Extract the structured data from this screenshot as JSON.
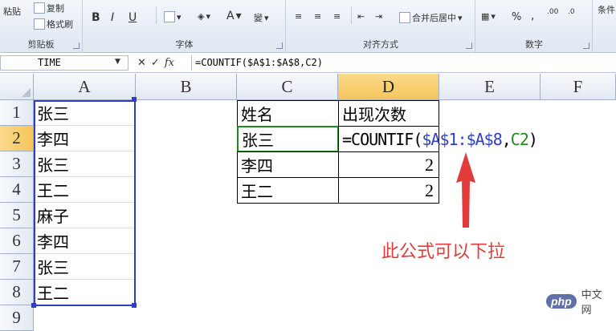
{
  "ribbon": {
    "clipboard": {
      "paste": "粘贴",
      "copy": "复制",
      "format_painter": "格式刷",
      "label": "剪贴板"
    },
    "font": {
      "label": "字体",
      "bold": "B",
      "italic": "I",
      "underline": "U"
    },
    "alignment": {
      "label": "对齐方式",
      "merge_center": "合并后居中"
    },
    "number": {
      "label": "数字",
      "percent": "%",
      "comma": ","
    },
    "conditional": "条件"
  },
  "formula_bar": {
    "name_box": "TIME",
    "cancel": "✕",
    "enter": "✓",
    "fx": "fx",
    "formula": "=COUNTIF($A$1:$A$8,C2)"
  },
  "columns": [
    "A",
    "B",
    "C",
    "D",
    "E",
    "F"
  ],
  "rows": [
    "1",
    "2",
    "3",
    "4",
    "5",
    "6",
    "7",
    "8",
    "9"
  ],
  "cells": {
    "A1": "张三",
    "A2": "李四",
    "A3": "张三",
    "A4": "王二",
    "A5": "麻子",
    "A6": "李四",
    "A7": "张三",
    "A8": "王二",
    "C1": "姓名",
    "C2": "张三",
    "C3": "李四",
    "C4": "王二",
    "D1": "出现次数",
    "D3": "2",
    "D4": "2"
  },
  "edit_cell": {
    "prefix": "=COUNTIF(",
    "range": "$A$1:$A$8",
    "comma": ",",
    "ref": "C2",
    "suffix": ")"
  },
  "annotation": "此公式可以下拉",
  "watermark": {
    "logo": "php",
    "site": "中文网"
  },
  "colors": {
    "range_blue": "#2f3fbf",
    "ref_green": "#1f8a1f",
    "annotation_red": "#e23b3b"
  }
}
